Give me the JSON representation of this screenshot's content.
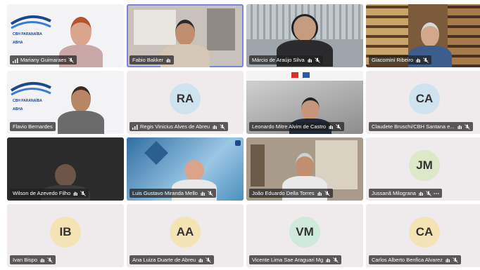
{
  "colors": {
    "accent": "#7b83eb",
    "plate": "#1e1e1e",
    "avatar_bg": "#efeaec"
  },
  "participants": [
    {
      "name": "Mariany Guimaraes",
      "kind": "video",
      "icons": [
        "signal-icon",
        "mic-muted-icon"
      ]
    },
    {
      "name": "Fabio Bakker",
      "kind": "video",
      "icons": [
        "raise-hand-icon"
      ]
    },
    {
      "name": "Márcio de Araújo Silva",
      "kind": "video",
      "icons": [
        "raise-hand-icon",
        "mic-muted-icon"
      ]
    },
    {
      "name": "Giacomini Ribeiro",
      "kind": "video",
      "icons": [
        "raise-hand-icon",
        "mic-muted-icon"
      ]
    },
    {
      "name": "Flavio Bernardes",
      "kind": "video",
      "icons": []
    },
    {
      "name": "Regis Vinicius Alves de Abreu",
      "kind": "avatar",
      "initials": "RA",
      "avatar_color": "#cfe3ee",
      "icons": [
        "signal-icon",
        "raise-hand-icon",
        "mic-muted-icon"
      ]
    },
    {
      "name": "Leonardo Mitre Alvim de Castro",
      "kind": "video",
      "icons": [
        "raise-hand-icon",
        "mic-muted-icon"
      ]
    },
    {
      "name": "Claudete Bruschi/CBH Santana e...",
      "kind": "avatar",
      "initials": "CA",
      "avatar_color": "#cfe3ee",
      "icons": [
        "raise-hand-icon",
        "mic-muted-icon"
      ]
    },
    {
      "name": "Wilson de Azevedo Filho",
      "kind": "video",
      "icons": [
        "raise-hand-icon",
        "mic-muted-icon"
      ]
    },
    {
      "name": "Luis Gustavo Miranda Mello",
      "kind": "video",
      "icons": [
        "raise-hand-icon",
        "mic-muted-icon"
      ]
    },
    {
      "name": "João Eduardo Della Torres",
      "kind": "video",
      "icons": [
        "raise-hand-icon",
        "mic-muted-icon"
      ]
    },
    {
      "name": "Jussanã Milograna",
      "kind": "avatar",
      "initials": "JM",
      "avatar_color": "#dce8c8",
      "icons": [
        "raise-hand-icon",
        "mic-muted-icon",
        "more-icon"
      ]
    },
    {
      "name": "Ivan Bispo",
      "kind": "avatar",
      "initials": "IB",
      "avatar_color": "#f4e3b5",
      "icons": [
        "raise-hand-icon",
        "mic-muted-icon"
      ]
    },
    {
      "name": "Ana Luiza Duarte de Abreu",
      "kind": "avatar",
      "initials": "AA",
      "avatar_color": "#f4e3b5",
      "icons": [
        "raise-hand-icon",
        "mic-muted-icon"
      ]
    },
    {
      "name": "Vicente Lima Sae Araguari Mg",
      "kind": "avatar",
      "initials": "VM",
      "avatar_color": "#cfe9dc",
      "icons": [
        "raise-hand-icon",
        "mic-muted-icon"
      ]
    },
    {
      "name": "Carlos Alberto Benfica Alvarez",
      "kind": "avatar",
      "initials": "CA",
      "avatar_color": "#f4e3b5",
      "icons": [
        "raise-hand-icon",
        "mic-muted-icon"
      ]
    }
  ],
  "logo": {
    "line1": "CBH PARANAÍBA",
    "line2": "ABHA"
  }
}
